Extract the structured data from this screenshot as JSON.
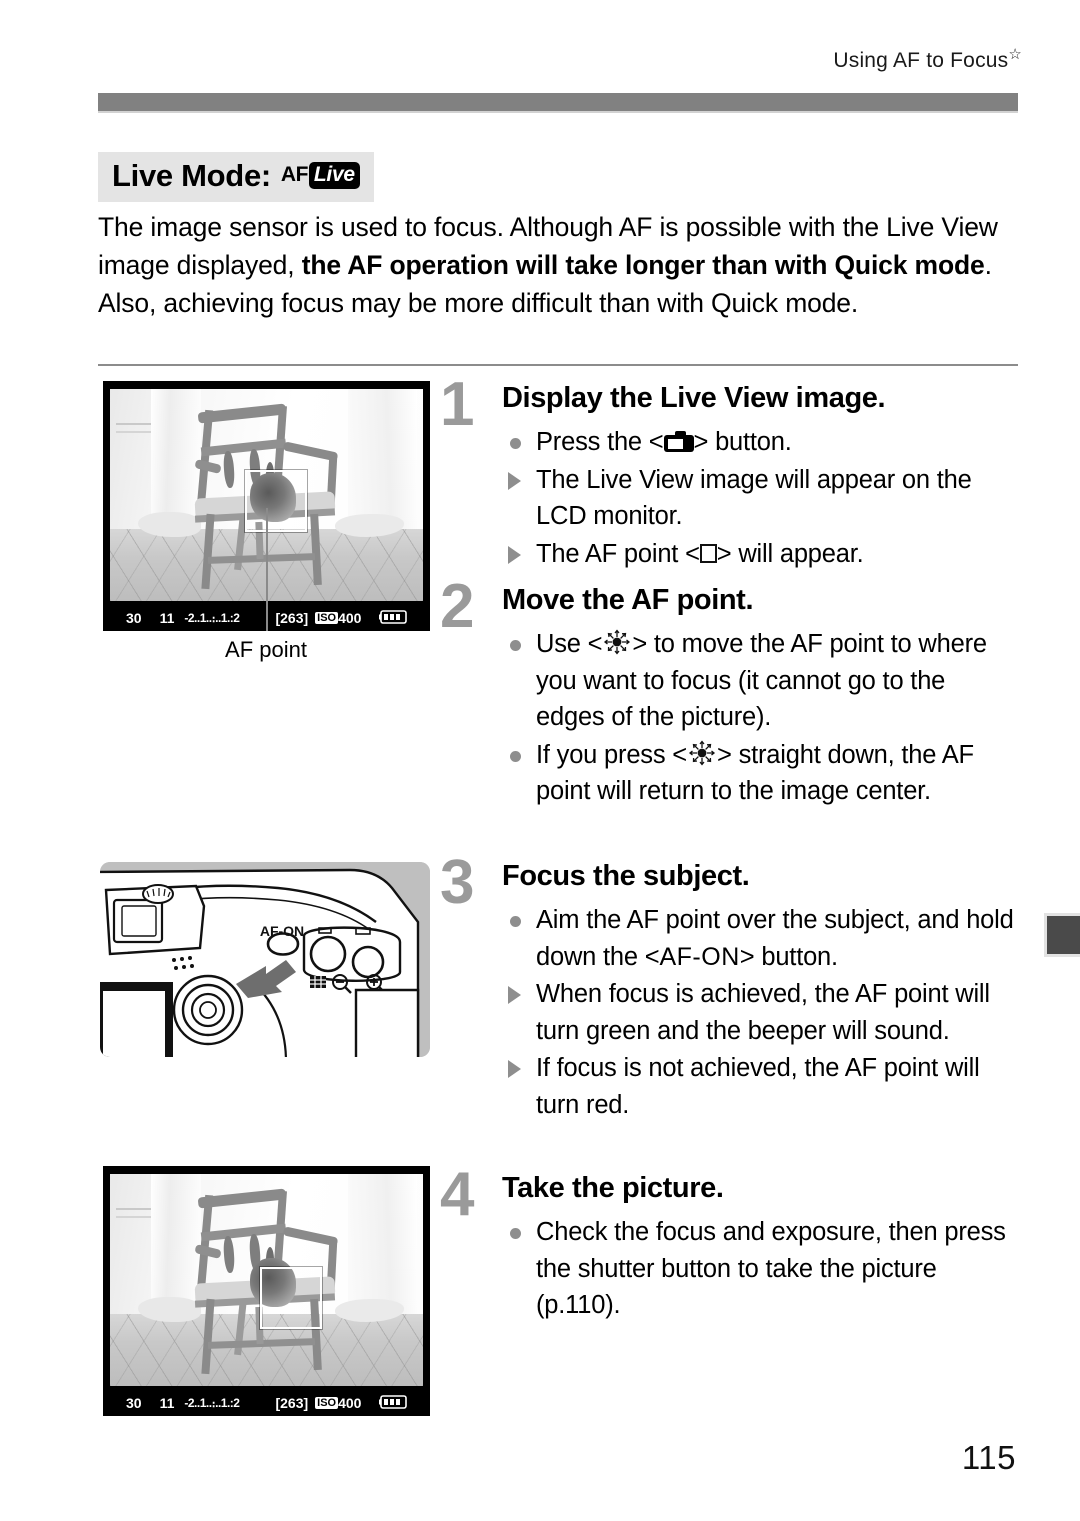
{
  "header": {
    "running_head": "Using AF to Focus",
    "star_glyph": "☆"
  },
  "section": {
    "heading_text": "Live Mode:",
    "mode_icon_af": "AF",
    "mode_icon_live": "Live"
  },
  "intro": {
    "part1": "The image sensor is used to focus. Although AF is possible with the Live View image displayed, ",
    "bold1": "the AF operation will take longer than with Quick mode",
    "part2": ". Also, achieving focus may be more difficult than with Quick mode."
  },
  "figures": {
    "lcd_top": {
      "name": "live-view-screen-af-point-center",
      "status": {
        "shutter_speed": "30",
        "aperture": "11",
        "exposure_scale": "-2..1..։..1.:2",
        "shots_remaining": "[263]",
        "iso_label": "ISO",
        "iso_value": "400",
        "battery": "battery-full"
      }
    },
    "lcd_caption": "AF point",
    "camera_diagram": {
      "name": "camera-rear-af-on-button",
      "button_label": "AF-ON"
    },
    "lcd_bottom": {
      "name": "live-view-screen-af-point-moved",
      "status": {
        "shutter_speed": "30",
        "aperture": "11",
        "exposure_scale": "-2..1..։..1.:2",
        "shots_remaining": "[263]",
        "iso_label": "ISO",
        "iso_value": "400",
        "battery": "battery-full"
      }
    }
  },
  "steps": [
    {
      "number": "1",
      "title": "Display the Live View image.",
      "items": [
        {
          "marker": "dot",
          "pre": "Press the <",
          "icon": "camera-icon",
          "post": "> button."
        },
        {
          "marker": "arrow",
          "text": "The Live View image will appear on the LCD monitor."
        },
        {
          "marker": "arrow",
          "pre": "The AF point <",
          "icon": "af-point-square-icon",
          "post": "> will appear."
        }
      ]
    },
    {
      "number": "2",
      "title": "Move the AF point.",
      "items": [
        {
          "marker": "dot",
          "pre": "Use <",
          "icon": "multi-controller-icon",
          "post": "> to move the AF point to where you want to focus (it cannot go to the edges of the picture)."
        },
        {
          "marker": "dot",
          "pre": "If you press <",
          "icon": "multi-controller-icon",
          "post": "> straight down, the AF point will return to the image center."
        }
      ]
    },
    {
      "number": "3",
      "title": "Focus the subject.",
      "items": [
        {
          "marker": "dot",
          "pre": "Aim the AF point over the subject, and hold down the <",
          "icon": "af-on-text",
          "icon_text": "AF-ON",
          "post": "> button."
        },
        {
          "marker": "arrow",
          "text": "When focus is achieved, the AF point will turn green and the beeper will sound."
        },
        {
          "marker": "arrow",
          "text": "If focus is not achieved, the AF point will turn red."
        }
      ]
    },
    {
      "number": "4",
      "title": "Take the picture.",
      "items": [
        {
          "marker": "dot",
          "text": "Check the focus and exposure, then press the shutter button to take the picture (p.110)."
        }
      ]
    }
  ],
  "folio": "115",
  "colors": {
    "band": "#818181",
    "step_number": "#9a9a9a",
    "marker": "#8e8e8e",
    "heading_bg": "#e4e4e4",
    "edge_tab": "#4a4a4a"
  }
}
